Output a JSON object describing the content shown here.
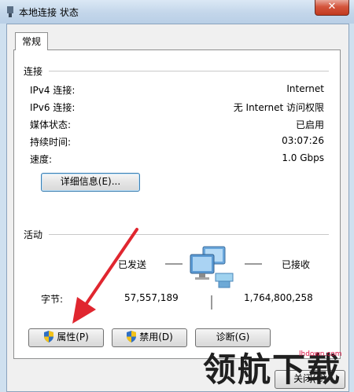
{
  "window": {
    "title": "本地连接 状态",
    "close_glyph": "✕"
  },
  "tabs": [
    {
      "label": "常规"
    }
  ],
  "connection": {
    "section_label": "连接",
    "rows": [
      {
        "label": "IPv4 连接:",
        "value": "Internet"
      },
      {
        "label": "IPv6 连接:",
        "value": "无 Internet 访问权限"
      },
      {
        "label": "媒体状态:",
        "value": "已启用"
      },
      {
        "label": "持续时间:",
        "value": "03:07:26"
      },
      {
        "label": "速度:",
        "value": "1.0 Gbps"
      }
    ],
    "details_button": "详细信息(E)..."
  },
  "activity": {
    "section_label": "活动",
    "sent_label": "已发送",
    "received_label": "已接收",
    "bytes_label": "字节:",
    "bytes_sent": "57,557,189",
    "bytes_received": "1,764,800,258"
  },
  "buttons": {
    "properties": "属性(P)",
    "disable": "禁用(D)",
    "diagnose": "诊断(G)",
    "close": "关闭(C)"
  },
  "watermark": {
    "text": "领航下载",
    "url": "lhdown.com"
  },
  "colors": {
    "arrow": "#e0262f",
    "shield_blue": "#2f6fc4",
    "shield_yellow": "#f3c219"
  }
}
